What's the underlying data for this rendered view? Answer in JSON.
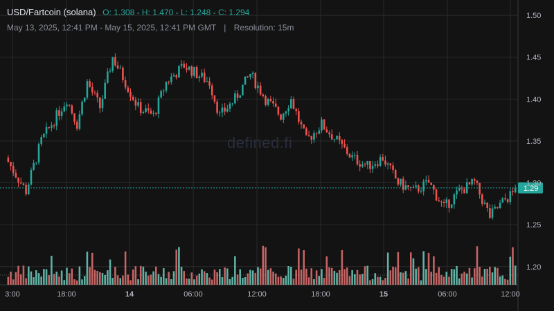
{
  "header": {
    "pair": "USD/Fartcoin (solana)",
    "ohlc": "O: 1.308 - H: 1.470 - L: 1.248 - C: 1.294",
    "range": "May 13, 2025, 12:41 PM - May 15, 2025, 12:41 PM GMT",
    "separator": "|",
    "resolution": "Resolution: 15m"
  },
  "watermark": "defined.fi",
  "chart_data": {
    "type": "candlestick",
    "title": "USD/Fartcoin (solana)",
    "interval": "15m",
    "ylim": [
      1.18,
      1.51
    ],
    "y_ticks": [
      1.2,
      1.25,
      1.3,
      1.35,
      1.4,
      1.45,
      1.5
    ],
    "y_tick_labels": [
      "1.20",
      "1.25",
      "1.30",
      "1.35",
      "1.40",
      "1.45",
      "1.50"
    ],
    "x_ticks": [
      "3:00",
      "18:00",
      "14",
      "06:00",
      "12:00",
      "18:00",
      "15",
      "06:00",
      "12:00"
    ],
    "bold_x_ticks": [
      "14",
      "15"
    ],
    "last_price": 1.294,
    "last_price_label": "1.29",
    "colors": {
      "up": "#26a69a",
      "down": "#ef5350",
      "background": "#131313",
      "grid": "#2a2a2a",
      "last_price": "#26a69a"
    },
    "path_keypoints": [
      [
        0,
        1.33
      ],
      [
        8,
        1.29
      ],
      [
        14,
        1.35
      ],
      [
        24,
        1.4
      ],
      [
        28,
        1.37
      ],
      [
        32,
        1.42
      ],
      [
        37,
        1.39
      ],
      [
        42,
        1.45
      ],
      [
        47,
        1.42
      ],
      [
        52,
        1.39
      ],
      [
        58,
        1.38
      ],
      [
        63,
        1.42
      ],
      [
        70,
        1.44
      ],
      [
        75,
        1.43
      ],
      [
        80,
        1.42
      ],
      [
        84,
        1.38
      ],
      [
        90,
        1.4
      ],
      [
        96,
        1.43
      ],
      [
        102,
        1.4
      ],
      [
        108,
        1.38
      ],
      [
        112,
        1.4
      ],
      [
        118,
        1.35
      ],
      [
        124,
        1.37
      ],
      [
        130,
        1.35
      ],
      [
        136,
        1.33
      ],
      [
        142,
        1.32
      ],
      [
        148,
        1.33
      ],
      [
        154,
        1.3
      ],
      [
        160,
        1.29
      ],
      [
        166,
        1.3
      ],
      [
        172,
        1.27
      ],
      [
        178,
        1.29
      ],
      [
        184,
        1.3
      ],
      [
        190,
        1.26
      ],
      [
        196,
        1.28
      ],
      [
        200,
        1.29
      ]
    ],
    "candle_count": 200,
    "volume": {
      "relative_max": 1.0,
      "note": "relative heights only, no scale shown"
    }
  }
}
